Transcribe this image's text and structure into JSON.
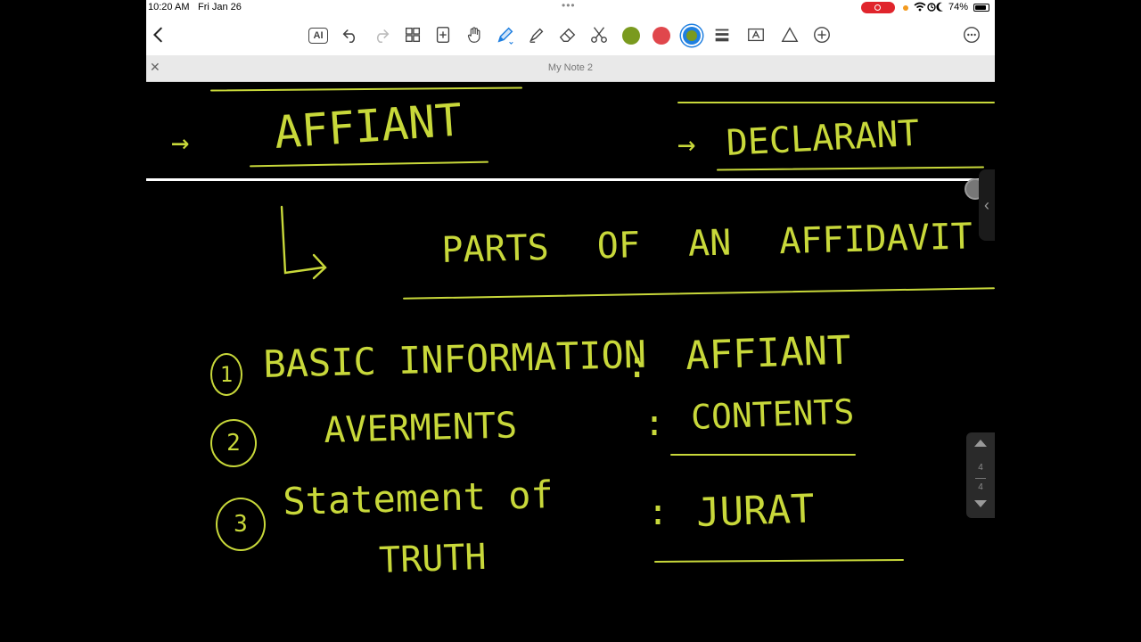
{
  "status_bar": {
    "time": "10:20 AM",
    "date": "Fri Jan 26",
    "battery": "74%"
  },
  "toolbar": {
    "ai_label": "AI",
    "icons": [
      "chevron-left-icon",
      "undo-icon",
      "redo-icon",
      "grid-icon",
      "add-page-icon",
      "hand-icon",
      "pen-icon",
      "highlighter-icon",
      "eraser-icon",
      "scissors-icon",
      "lines-icon",
      "textbox-icon",
      "shape-icon",
      "plus-circle-icon",
      "more-icon"
    ],
    "colors": {
      "olive": "#7a9a1f",
      "red": "#e0474c",
      "blue_selected": "#1f7fe0"
    }
  },
  "document": {
    "title": "My Note 2"
  },
  "canvas": {
    "ink_color": "#c8d83a",
    "texts": {
      "affiant_top": "AFFIANT",
      "declarant": "DECLARANT",
      "parts_heading": "PARTS OF AN AFFIDAVIT",
      "item1_label": "BASIC INFORMATION",
      "item1_value": "AFFIANT",
      "item2_label": "AVERMENTS",
      "item2_value": "CONTENTS",
      "item3_label_line1": "Statement of",
      "item3_label_line2": "TRUTH",
      "item3_value": "JURAT",
      "num1": "1",
      "num2": "2",
      "num3": "3",
      "arrow": "→",
      "colon": ":"
    }
  },
  "pager": {
    "current": "4",
    "total": "4"
  }
}
